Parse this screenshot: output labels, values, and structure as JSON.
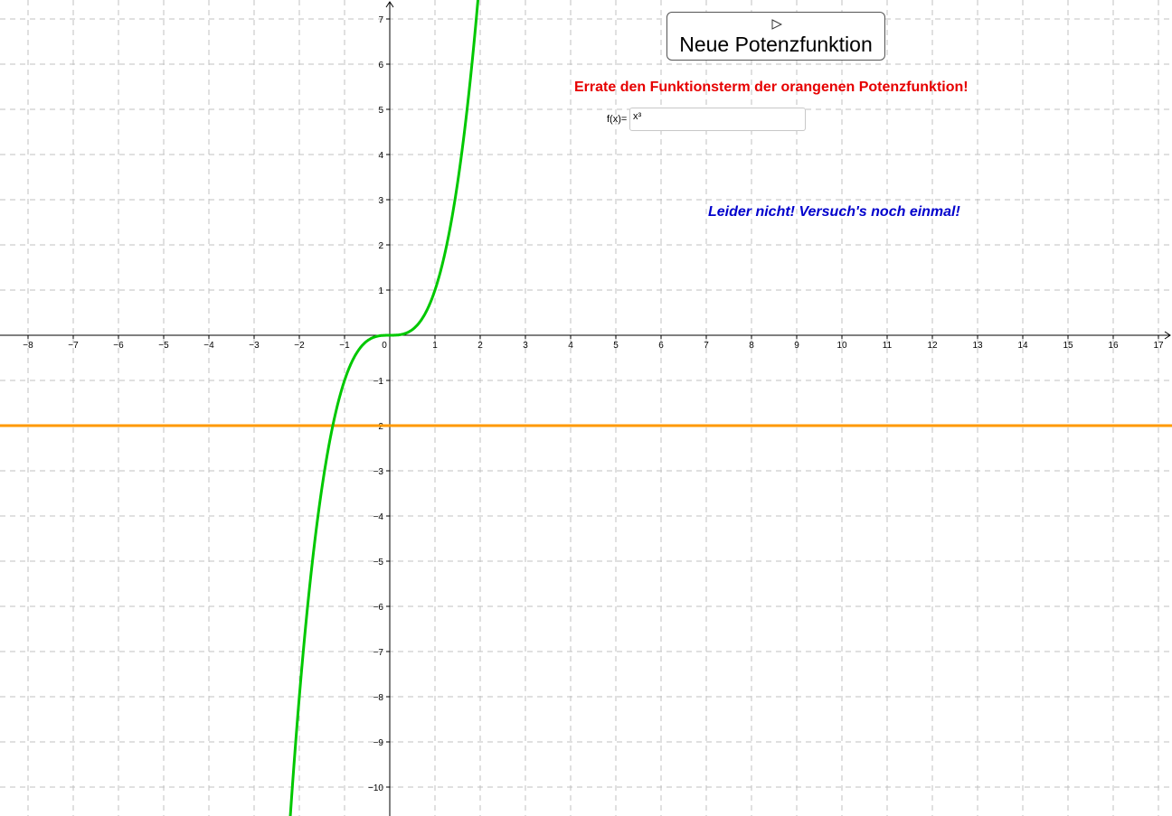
{
  "new_function_button": {
    "label": "Neue Potenzfunktion",
    "icon": "play-icon"
  },
  "prompt": "Errate den Funktionsterm der orangenen Potenzfunktion!",
  "input": {
    "label": "f(x)=",
    "value": "x³"
  },
  "feedback": "Leider nicht! Versuch's noch einmal!",
  "colors": {
    "prompt": "#e60000",
    "feedback": "#0000cc",
    "guess_curve": "#00c800",
    "target_curve": "#ff9900",
    "grid": "#c0c0c0"
  },
  "chart_data": {
    "type": "line",
    "xlim": [
      -8.4,
      17.3
    ],
    "ylim": [
      -10.6,
      7.4
    ],
    "x_ticks": [
      -8,
      -7,
      -6,
      -5,
      -4,
      -3,
      -2,
      -1,
      0,
      1,
      2,
      3,
      4,
      5,
      6,
      7,
      8,
      9,
      10,
      11,
      12,
      13,
      14,
      15,
      16,
      17
    ],
    "y_ticks": [
      7,
      6,
      5,
      4,
      3,
      2,
      1,
      -1,
      -2,
      -3,
      -4,
      -5,
      -6,
      -7,
      -8,
      -9,
      -10
    ],
    "grid": true,
    "series": [
      {
        "name": "f(x)= x³",
        "formula": "x^3",
        "color": "#00c800"
      },
      {
        "formula": "-2",
        "color": "#ff9900"
      }
    ]
  }
}
